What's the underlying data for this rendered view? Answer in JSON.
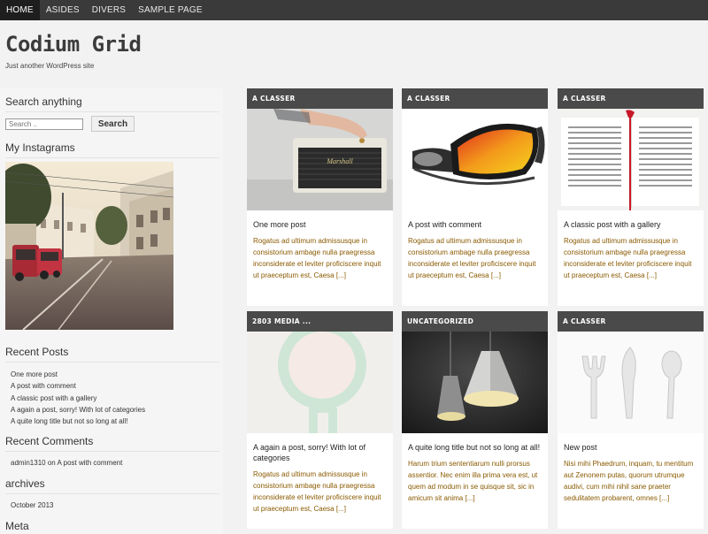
{
  "nav": {
    "items": [
      {
        "label": "HOME",
        "active": true
      },
      {
        "label": "ASIDES",
        "active": false
      },
      {
        "label": "DIVERS",
        "active": false
      },
      {
        "label": "SAMPLE PAGE",
        "active": false
      }
    ]
  },
  "site": {
    "title": "Codium Grid",
    "description": "Just another WordPress site"
  },
  "sidebar": {
    "search": {
      "title": "Search anything",
      "placeholder": "Search ..",
      "button": "Search"
    },
    "instagram": {
      "title": "My Instagrams"
    },
    "recent_posts": {
      "title": "Recent Posts",
      "items": [
        "One more post",
        "A post with comment",
        "A classic post with a gallery",
        "A again a post, sorry! With lot of categories",
        "A quite long title but not so long at all!"
      ]
    },
    "recent_comments": {
      "title": "Recent Comments",
      "author": "admin1310",
      "on_text": "on",
      "post": "A post with comment"
    },
    "archives": {
      "title": "archives",
      "items": [
        "October 2013"
      ]
    },
    "meta": {
      "title": "Meta"
    }
  },
  "posts": [
    {
      "category": "A CLASSER",
      "title": "One more post",
      "excerpt": "Rogatus ad ultimum admissusque in consistorium ambage nulla praegressa inconsiderate et leviter proficiscere inquit ut praeceptum est, Caesa [...]",
      "image": "speaker"
    },
    {
      "category": "A CLASSER",
      "title": "A post with comment",
      "excerpt": "Rogatus ad ultimum admissusque in consistorium ambage nulla praegressa inconsiderate et leviter proficiscere inquit ut praeceptum est, Caesa [...]",
      "image": "goggles"
    },
    {
      "category": "A CLASSER",
      "title": "A classic post with a gallery",
      "excerpt": "Rogatus ad ultimum admissusque in consistorium ambage nulla praegressa inconsiderate et leviter proficiscere inquit ut praeceptum est, Caesa [...]",
      "image": "book"
    },
    {
      "category": "2803 MEDIA ...",
      "title": "A again a post, sorry! With lot of categories",
      "excerpt": "Rogatus ad ultimum admissusque in consistorium ambage nulla praegressa inconsiderate et leviter proficiscere inquit ut praeceptum est, Caesa [...]",
      "image": "magnifier"
    },
    {
      "category": "UNCATEGORIZED",
      "title": "A quite long title but not so long at all!",
      "excerpt": "Harum trium sententiarum nulli prorsus assentior. Nec enim illa prima vera est, ut quem ad modum in se quisque sit, sic in amicum sit anima [...]",
      "image": "lamps"
    },
    {
      "category": "A CLASSER",
      "title": "New post",
      "excerpt": "Nisi mihi Phaedrum, inquam, tu mentitum aut Zenonem putas, quorum utrumque audivi, cum mihi nihil sane praeter sedulitatem probarent, omnes [...]",
      "image": "utensils"
    }
  ]
}
